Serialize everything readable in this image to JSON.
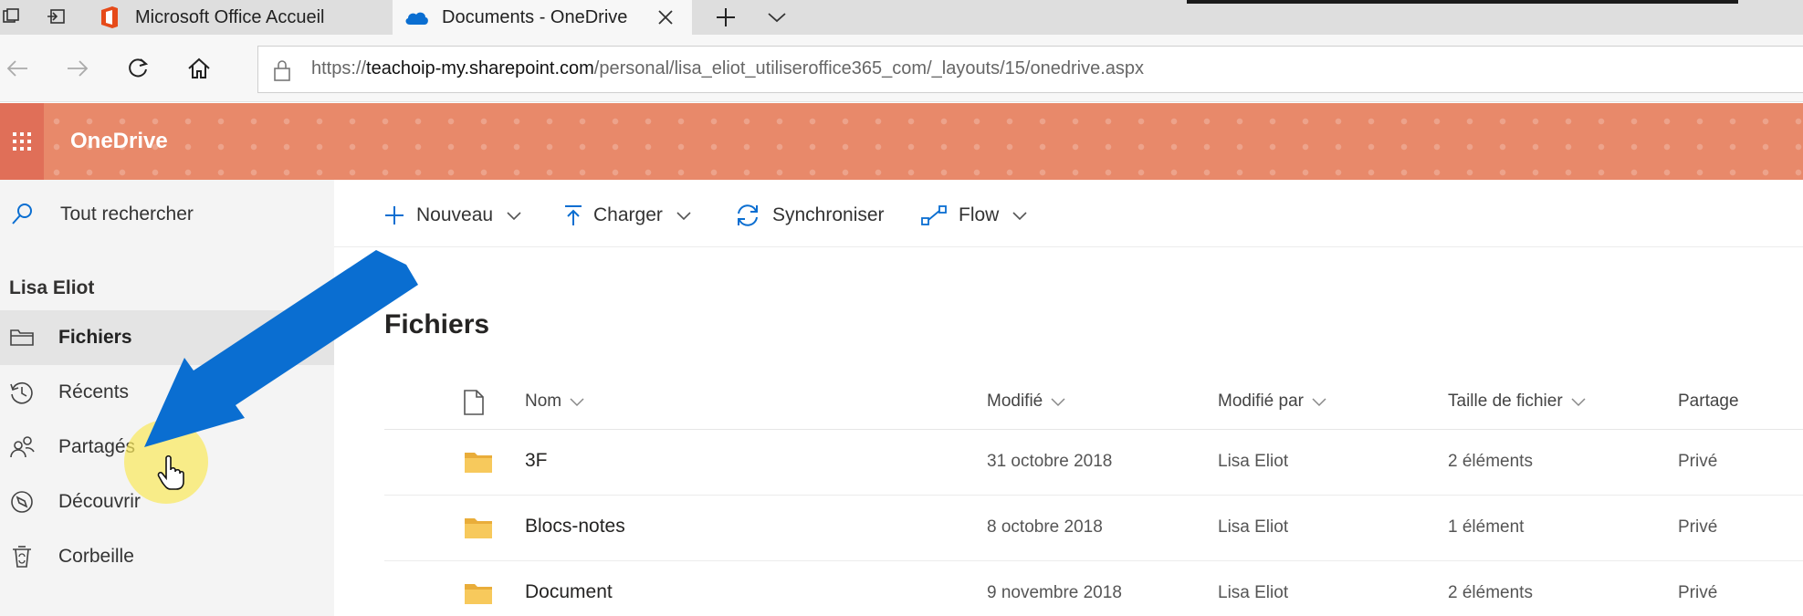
{
  "browser": {
    "tabs": [
      {
        "title": "Microsoft Office Accueil",
        "active": false
      },
      {
        "title": "Documents - OneDrive",
        "active": true
      }
    ],
    "url": {
      "scheme": "https://",
      "host": "teachoip-my.sharepoint.com",
      "path": "/personal/lisa_eliot_utiliseroffice365_com/_layouts/15/onedrive.aspx"
    }
  },
  "suite": {
    "app_name": "OneDrive",
    "brand_color": "#e8896a"
  },
  "sidebar": {
    "search_label": "Tout rechercher",
    "user_name": "Lisa Eliot",
    "items": [
      {
        "label": "Fichiers",
        "icon": "files-icon",
        "selected": true
      },
      {
        "label": "Récents",
        "icon": "recent-icon",
        "selected": false
      },
      {
        "label": "Partagés",
        "icon": "shared-icon",
        "selected": false
      },
      {
        "label": "Découvrir",
        "icon": "discover-icon",
        "selected": false
      },
      {
        "label": "Corbeille",
        "icon": "recycle-bin-icon",
        "selected": false
      }
    ]
  },
  "commands": {
    "new": "Nouveau",
    "upload": "Charger",
    "sync": "Synchroniser",
    "flow": "Flow"
  },
  "main": {
    "title": "Fichiers",
    "columns": {
      "name": "Nom",
      "modified": "Modifié",
      "modified_by": "Modifié par",
      "size": "Taille de fichier",
      "sharing": "Partage"
    },
    "rows": [
      {
        "name": "3F",
        "modified": "31 octobre 2018",
        "modified_by": "Lisa Eliot",
        "size": "2 éléments",
        "sharing": "Privé"
      },
      {
        "name": "Blocs-notes",
        "modified": "8 octobre 2018",
        "modified_by": "Lisa Eliot",
        "size": "1 élément",
        "sharing": "Privé"
      },
      {
        "name": "Document",
        "modified": "9 novembre 2018",
        "modified_by": "Lisa Eliot",
        "size": "2 éléments",
        "sharing": "Privé"
      }
    ]
  },
  "colors": {
    "accent_blue": "#0a6ed1",
    "folder_yellow": "#f2c14e",
    "highlight_yellow": "#fae85a"
  }
}
